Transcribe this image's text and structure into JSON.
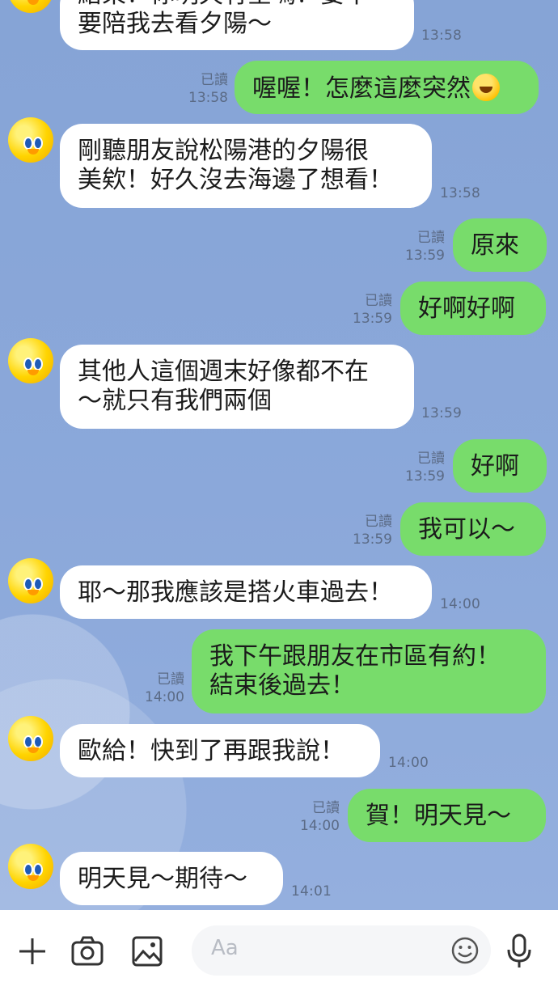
{
  "messages": {
    "m1_line1": "結束！你明天有空嗎？要不",
    "m1_line2": "要陪我去看夕陽～",
    "m1_time": "13:58",
    "m2_text": "喔喔！怎麼這麼突然",
    "m2_emoji": "rolling-on-floor-laughing-emoji",
    "m2_read": "已讀",
    "m2_time": "13:58",
    "m3_line1": "剛聽朋友說松陽港的夕陽很",
    "m3_line2": "美欸！好久沒去海邊了想看！",
    "m3_time": "13:58",
    "m4_text": "原來",
    "m4_read": "已讀",
    "m4_time": "13:59",
    "m5_text": "好啊好啊",
    "m5_read": "已讀",
    "m5_time": "13:59",
    "m6_line1": "其他人這個週末好像都不在",
    "m6_line2": "～就只有我們兩個",
    "m6_time": "13:59",
    "m7_text": "好啊",
    "m7_read": "已讀",
    "m7_time": "13:59",
    "m8_text": "我可以～",
    "m8_read": "已讀",
    "m8_time": "13:59",
    "m9_text": "耶～那我應該是搭火車過去！",
    "m9_time": "14:00",
    "m10_line1": "我下午跟朋友在市區有約！",
    "m10_line2": "結束後過去！",
    "m10_read": "已讀",
    "m10_time": "14:00",
    "m11_text": "歐給！快到了再跟我說！",
    "m11_time": "14:00",
    "m12_text": "賀！明天見～",
    "m12_read": "已讀",
    "m12_time": "14:00",
    "m13_text": "明天見～期待～",
    "m13_time": "14:01"
  },
  "input": {
    "placeholder": "Aa"
  },
  "icons": {
    "plus": "plus-icon",
    "camera": "camera-icon",
    "image": "image-icon",
    "emoji": "smiley-icon",
    "mic": "microphone-icon"
  },
  "colors": {
    "background": "#8aa6d5",
    "incoming_bubble": "#ffffff",
    "outgoing_bubble": "#78dc6b",
    "timestamp": "#5b6b86"
  }
}
